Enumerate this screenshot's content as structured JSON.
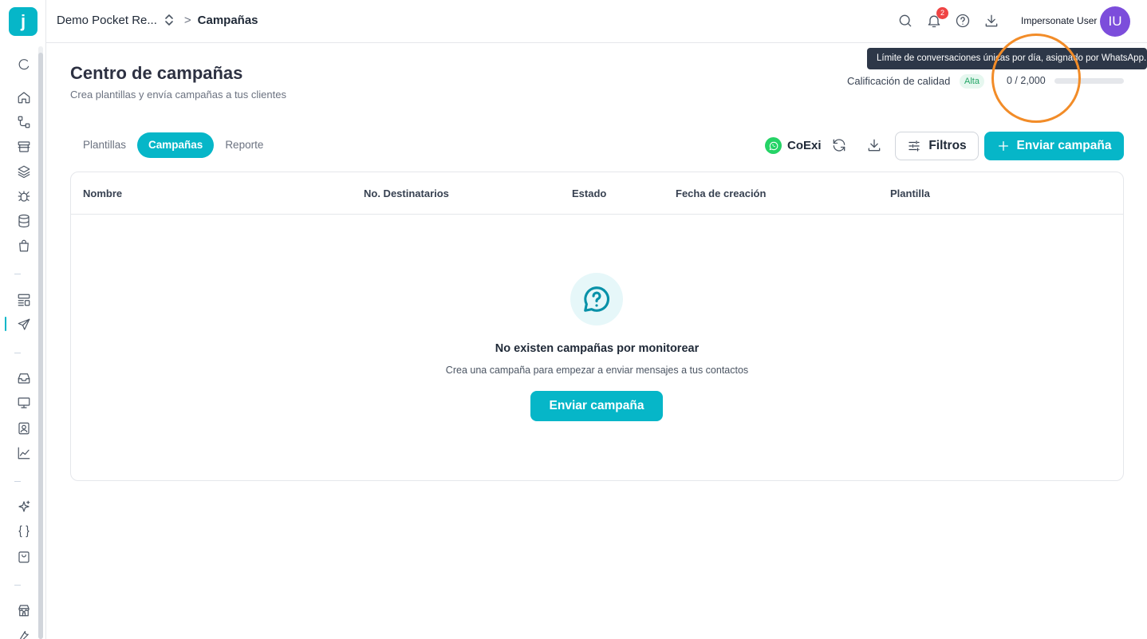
{
  "header": {
    "org_name": "Demo Pocket Re...",
    "breadcrumb_separator": ">",
    "current_page": "Campañas",
    "notification_count": "2",
    "user_name": "Impersonate User",
    "avatar_initials": "IU"
  },
  "sidebar": {
    "logo_letter": "j",
    "icons": [
      "refresh-icon",
      "home-icon",
      "flow-icon",
      "archive-icon",
      "layers-icon",
      "bug-icon",
      "database-icon",
      "shopping-bag-icon",
      "layout-icon",
      "send-icon",
      "inbox-icon",
      "monitor-icon",
      "contact-icon",
      "chart-icon",
      "sparkles-icon",
      "code-braces-icon",
      "shopping-basket-icon",
      "store-icon"
    ],
    "active_item": "send-icon"
  },
  "tooltip": {
    "text": "Límite de conversaciones únicas por día, asignado por WhatsApp."
  },
  "page": {
    "title": "Centro de campañas",
    "subtitle": "Crea plantillas y envía campañas a tus clientes"
  },
  "quality": {
    "label": "Calificación de calidad",
    "badge": "Alta",
    "quota_text": "0 / 2,000",
    "quota_fraction": 0
  },
  "tabs": [
    {
      "label": "Plantillas",
      "active": false
    },
    {
      "label": "Campañas",
      "active": true
    },
    {
      "label": "Reporte",
      "active": false
    }
  ],
  "toolbar": {
    "channel_name": "CoExi",
    "filters_label": "Filtros",
    "send_label": "Enviar campaña"
  },
  "table": {
    "columns": [
      "Nombre",
      "No. Destinatarios",
      "Estado",
      "Fecha de creación",
      "Plantilla"
    ]
  },
  "empty_state": {
    "title": "No existen campañas por monitorear",
    "subtitle": "Crea una campaña para empezar a enviar mensajes a tus contactos",
    "button_label": "Enviar campaña"
  },
  "colors": {
    "accent": "#06b6c8",
    "avatar": "#7c4ddb",
    "badge_red": "#ef4444",
    "highlight": "#f28c28",
    "quality_green": "#22a565"
  }
}
